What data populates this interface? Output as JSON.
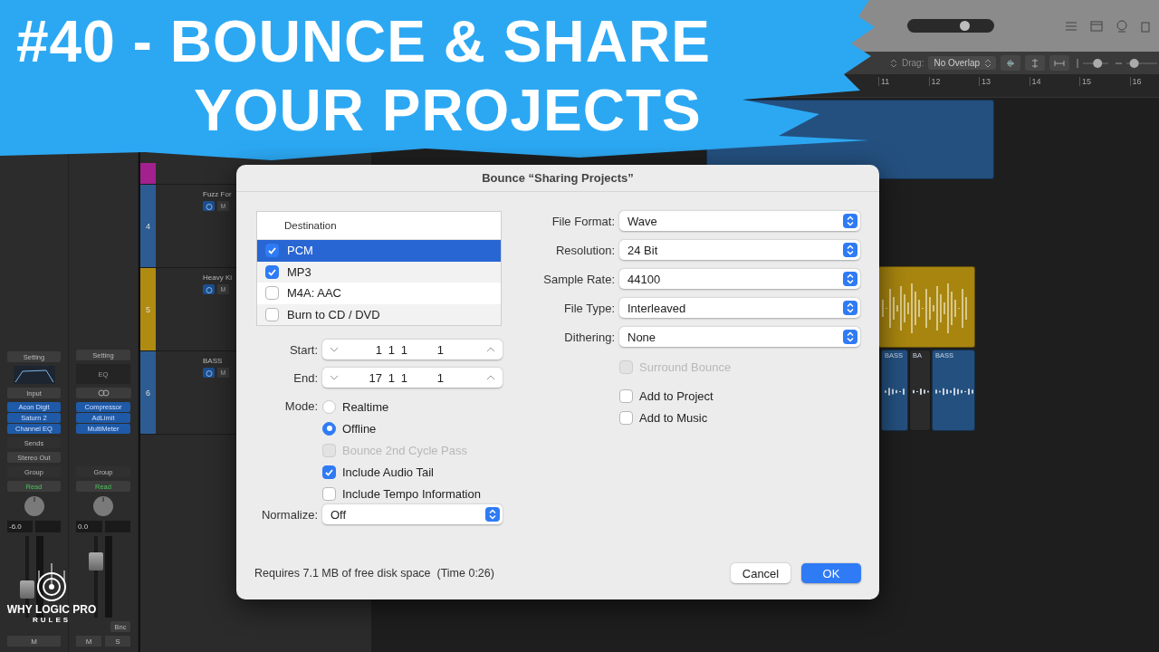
{
  "title_overlay": {
    "lines": [
      "#40 - BOUNCE & SHARE",
      "YOUR PROJECTS"
    ]
  },
  "branding": {
    "lines": [
      "WHY LOGIC PRO",
      "RULES"
    ]
  },
  "toolbar": {
    "zoom": {
      "level": 0.68
    },
    "drag_label": "Drag:",
    "drag_value": "No Overlap",
    "vertical_zoom": {
      "level": 0.6
    },
    "horizontal_zoom": {
      "level": 0.15
    }
  },
  "ruler": [
    "11",
    "12",
    "13",
    "14",
    "15",
    "16"
  ],
  "mixer_strips": [
    {
      "setting": "Setting",
      "kind": "input",
      "input": "Input",
      "plugins": [
        "Acon Digit",
        "Saturn 2",
        "Channel EQ"
      ],
      "sends": "Sends",
      "output": "Stereo Out",
      "group": "Group",
      "automation": "Read",
      "volume": "-6.0",
      "level": 0.3,
      "buttons": [
        "M"
      ]
    },
    {
      "setting": "Setting",
      "kind": "eq",
      "eq": "EQ",
      "plugins": [
        "Compressor",
        "AdLimit",
        "MultiMeter"
      ],
      "group": "Group",
      "automation": "Read",
      "volume": "0.0",
      "level": 0.75,
      "bounce": "Bnc",
      "buttons": [
        "M",
        "S"
      ]
    }
  ],
  "tracks": [
    {
      "color": "#a3218e"
    },
    {
      "number": "4",
      "name": "Fuzz For",
      "mute": "M",
      "color": "#2d5c92"
    },
    {
      "number": "5",
      "name": "Heavy Ki",
      "mute": "M",
      "color": "#b08b12"
    },
    {
      "number": "6",
      "name": "BASS",
      "mute": "M",
      "color": "#2d5c92"
    }
  ],
  "regions": [
    {
      "kind": "midi",
      "color": "#24507f"
    },
    {
      "kind": "drums",
      "color": "#a8850f"
    },
    {
      "kind": "audio",
      "color": "#24507f",
      "name": "BASS"
    },
    {
      "kind": "audio",
      "color": "#2b2b2b",
      "name": "BA"
    },
    {
      "kind": "audio",
      "color": "#24507f",
      "name": "BASS"
    }
  ],
  "dialog": {
    "title": "Bounce “Sharing Projects”",
    "destination_header": "Destination",
    "destinations": [
      {
        "label": "PCM",
        "checked": true,
        "selected": true
      },
      {
        "label": "MP3",
        "checked": true,
        "selected": false
      },
      {
        "label": "M4A: AAC",
        "checked": false,
        "selected": false
      },
      {
        "label": "Burn to CD / DVD",
        "checked": false,
        "selected": false
      }
    ],
    "start": {
      "label": "Start:",
      "parts": [
        "1",
        "1",
        "1",
        "1"
      ]
    },
    "end": {
      "label": "End:",
      "parts": [
        "17",
        "1",
        "1",
        "1"
      ]
    },
    "mode": {
      "label": "Mode:",
      "options": [
        {
          "label": "Realtime",
          "selected": false
        },
        {
          "label": "Offline",
          "selected": true
        }
      ]
    },
    "options": [
      {
        "label": "Bounce 2nd Cycle Pass",
        "checked": false,
        "disabled": true
      },
      {
        "label": "Include Audio Tail",
        "checked": true,
        "disabled": false
      },
      {
        "label": "Include Tempo Information",
        "checked": false,
        "disabled": false
      }
    ],
    "normalize": {
      "label": "Normalize:",
      "value": "Off"
    },
    "settings": [
      {
        "label": "File Format:",
        "value": "Wave"
      },
      {
        "label": "Resolution:",
        "value": "24 Bit"
      },
      {
        "label": "Sample Rate:",
        "value": "44100"
      },
      {
        "label": "File Type:",
        "value": "Interleaved"
      },
      {
        "label": "Dithering:",
        "value": "None"
      }
    ],
    "surround": {
      "label": "Surround Bounce",
      "checked": false,
      "disabled": true
    },
    "add_to": [
      {
        "label": "Add to Project",
        "checked": false,
        "disabled": false
      },
      {
        "label": "Add to Music",
        "checked": false,
        "disabled": false
      }
    ],
    "footer": "Requires 7.1 MB of free disk space  (Time 0:26)",
    "buttons": [
      {
        "label": "Cancel",
        "kind": "secondary"
      },
      {
        "label": "OK",
        "kind": "primary"
      }
    ]
  }
}
